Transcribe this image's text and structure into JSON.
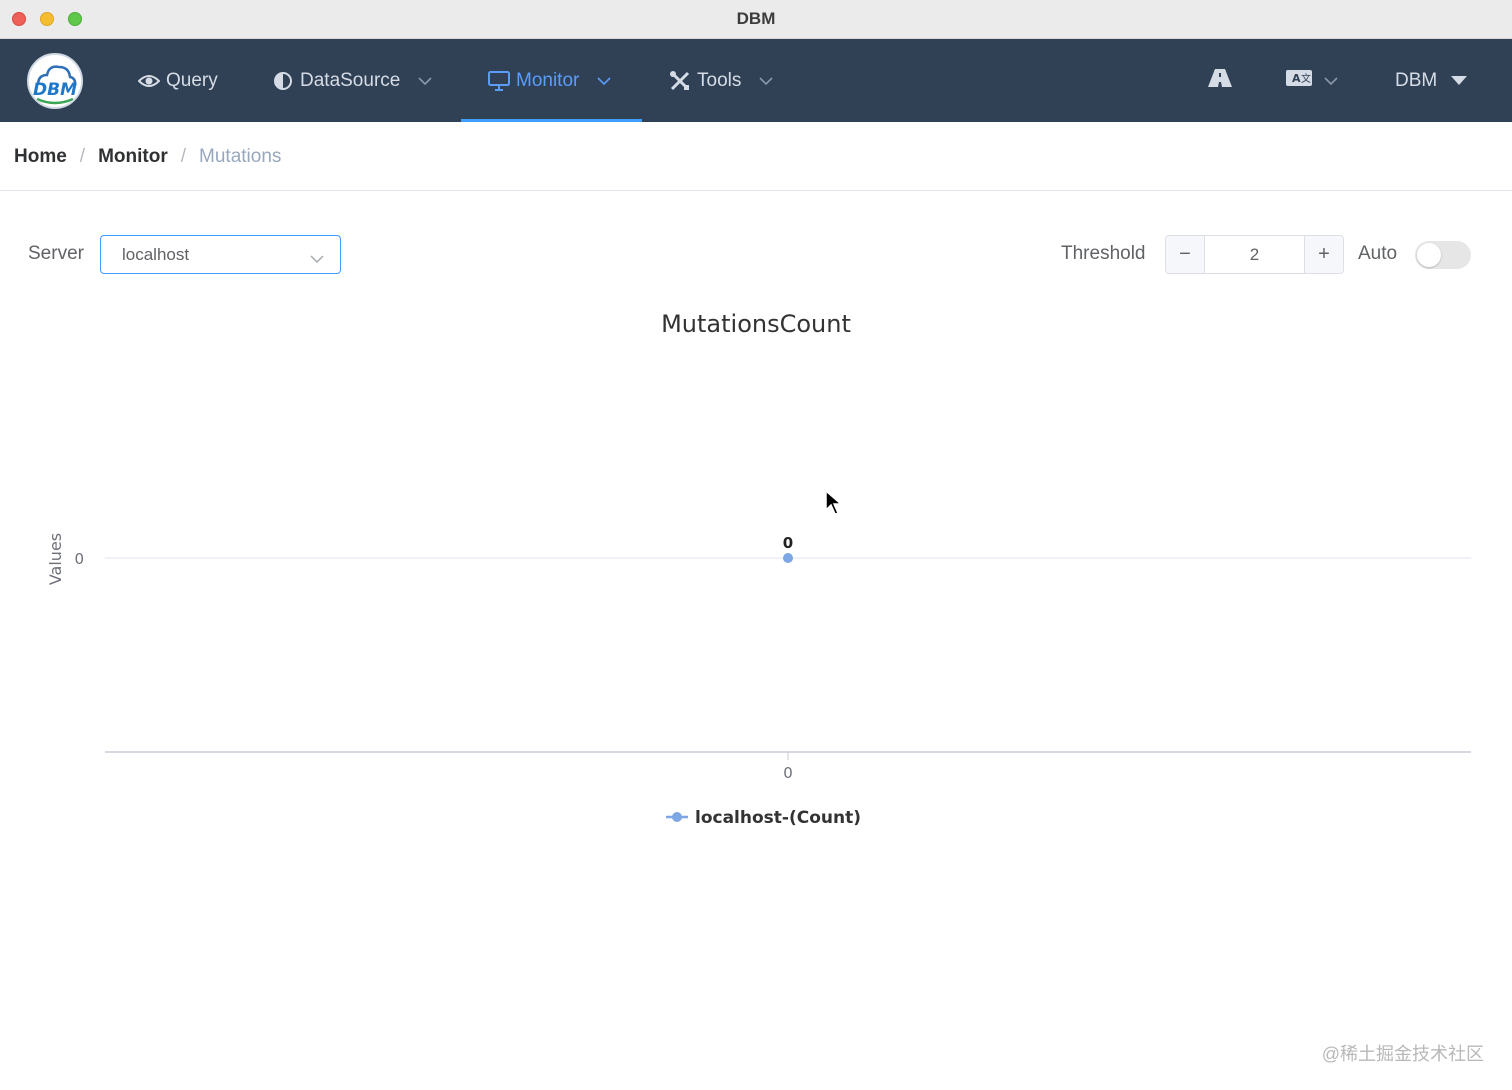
{
  "window": {
    "title": "DBM"
  },
  "nav": {
    "items": [
      {
        "label": "Query",
        "icon": "eye-icon",
        "has_dropdown": false,
        "active": false
      },
      {
        "label": "DataSource",
        "icon": "half-circle-icon",
        "has_dropdown": true,
        "active": false
      },
      {
        "label": "Monitor",
        "icon": "monitor-icon",
        "has_dropdown": true,
        "active": true
      },
      {
        "label": "Tools",
        "icon": "tools-icon",
        "has_dropdown": true,
        "active": false
      }
    ],
    "user_label": "DBM",
    "colors": {
      "background": "#304156",
      "active": "#409eff"
    }
  },
  "breadcrumb": {
    "home": "Home",
    "section": "Monitor",
    "current": "Mutations",
    "separator": "/"
  },
  "controls": {
    "server_label": "Server",
    "server_value": "localhost",
    "threshold_label": "Threshold",
    "threshold_value": "2",
    "minus": "−",
    "plus": "+",
    "auto_label": "Auto",
    "auto_enabled": false
  },
  "chart_data": {
    "type": "line",
    "title": "MutationsCount",
    "ylabel": "Values",
    "xlabel": "",
    "x": [
      0
    ],
    "series": [
      {
        "name": "localhost-(Count)",
        "values": [
          0
        ],
        "color": "#7ca6e4"
      }
    ],
    "y_ticks": [
      "0"
    ],
    "x_ticks": [
      "0"
    ],
    "data_labels": [
      "0"
    ],
    "legend_position": "bottom-center",
    "grid": true
  },
  "watermark": "@稀土掘金技术社区"
}
